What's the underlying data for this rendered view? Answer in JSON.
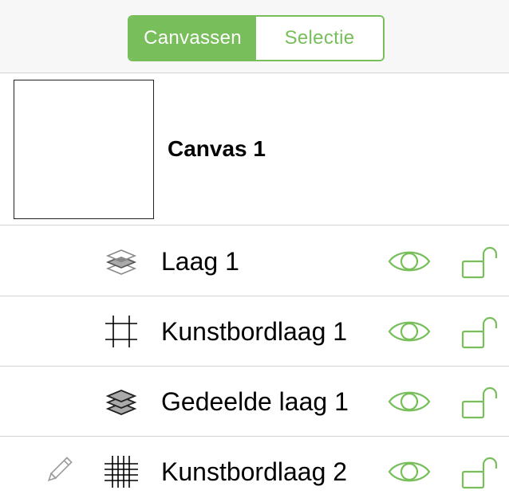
{
  "tabs": {
    "canvases_label": "Canvassen",
    "selection_label": "Selectie",
    "active": "canvases"
  },
  "canvas": {
    "title": "Canvas 1"
  },
  "layers": [
    {
      "name": "Laag 1",
      "icon": "layer-icon",
      "visible": true,
      "locked": false
    },
    {
      "name": "Kunstbordlaag 1",
      "icon": "artboard-layer-icon",
      "visible": true,
      "locked": false
    },
    {
      "name": "Gedeelde laag 1",
      "icon": "shared-layer-icon",
      "visible": true,
      "locked": false
    },
    {
      "name": "Kunstbordlaag 2",
      "icon": "artboard-layer-grid-icon",
      "visible": true,
      "locked": false,
      "editing": true
    }
  ],
  "colors": {
    "accent": "#78be5a",
    "separator": "#d4d4d4",
    "header_bg": "#f7f7f7"
  }
}
